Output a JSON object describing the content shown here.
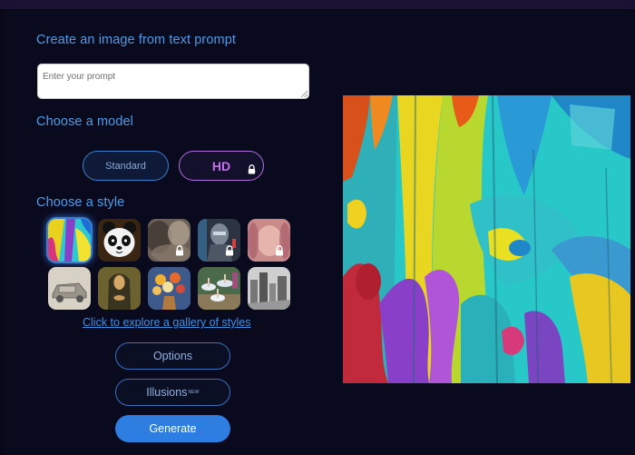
{
  "header": {
    "title": "Create an image from text prompt"
  },
  "prompt": {
    "placeholder": "Enter your prompt",
    "value": ""
  },
  "model": {
    "heading": "Choose a model",
    "standard_label": "Standard",
    "hd_label": "HD",
    "hd_locked": true
  },
  "style": {
    "heading": "Choose a style",
    "gallery_link": "Click to explore a gallery of styles",
    "items": [
      {
        "icon": "abstract-colorful-thumbnail",
        "locked": false,
        "selected": true
      },
      {
        "icon": "panda-thumbnail",
        "locked": false,
        "selected": false
      },
      {
        "icon": "blurred-photo-thumbnail",
        "locked": true,
        "selected": false
      },
      {
        "icon": "cyborg-thumbnail",
        "locked": true,
        "selected": false
      },
      {
        "icon": "pink-portrait-thumbnail",
        "locked": true,
        "selected": false
      },
      {
        "icon": "pencil-sketch-car-thumbnail",
        "locked": false,
        "selected": false
      },
      {
        "icon": "mona-lisa-thumbnail",
        "locked": false,
        "selected": false
      },
      {
        "icon": "flower-vase-thumbnail",
        "locked": false,
        "selected": false
      },
      {
        "icon": "ballet-dancers-thumbnail",
        "locked": false,
        "selected": false
      },
      {
        "icon": "city-sketch-thumbnail",
        "locked": false,
        "selected": false
      }
    ]
  },
  "buttons": {
    "options_label": "Options",
    "illusions_label": "Illusions",
    "illusions_badge": "NEW",
    "generate_label": "Generate"
  },
  "colors": {
    "accent": "#2d7ee0",
    "heading": "#4d9be8",
    "hd_purple": "#c66ef0",
    "background": "#0a0a1e"
  }
}
